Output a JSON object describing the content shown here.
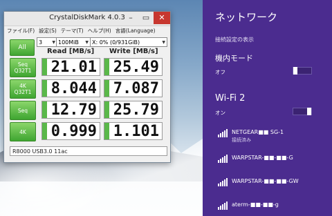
{
  "window": {
    "title": "CrystalDiskMark 4.0.3",
    "menu": [
      "ファイル(F)",
      "設定(S)",
      "テーマ(T)",
      "ヘルプ(H)",
      "言語(Language)"
    ],
    "all_label": "All",
    "runs": "3",
    "size": "100MiB",
    "drive": "X: 0% (0/931GiB)",
    "read_header": "Read [MB/s]",
    "write_header": "Write [MB/s]",
    "tests": [
      {
        "line1": "Seq",
        "line2": "Q32T1",
        "read": "21.01",
        "write": "25.49"
      },
      {
        "line1": "4K",
        "line2": "Q32T1",
        "read": "8.044",
        "write": "7.087"
      },
      {
        "line1": "Seq",
        "line2": "",
        "read": "12.79",
        "write": "25.79"
      },
      {
        "line1": "4K",
        "line2": "",
        "read": "0.999",
        "write": "1.101"
      }
    ],
    "comment": "R8000 USB3.0 11ac"
  },
  "network": {
    "title": "ネットワーク",
    "show_settings": "接続設定の表示",
    "airplane": {
      "label": "機内モード",
      "state": "オフ",
      "on": false
    },
    "wifi": {
      "label": "Wi-Fi 2",
      "state": "オン",
      "on": true
    },
    "networks": [
      {
        "name": "NETGEAR■■ SG-1",
        "status": "接続済み"
      },
      {
        "name": "WARPSTAR-■■-■■-G",
        "status": ""
      },
      {
        "name": "WARPSTAR-■■-■■-GW",
        "status": ""
      },
      {
        "name": "aterm-■■-■■-g",
        "status": ""
      }
    ]
  },
  "colors": {
    "flyout_bg": "#4b2c8f",
    "accent_green": "#3fa531",
    "close_red": "#c7372f"
  },
  "icons": {
    "wifi": "wifi-signal-icon",
    "close": "close-icon",
    "minimize": "minimize-icon",
    "maximize": "maximize-icon",
    "dropdown": "chevron-down-icon"
  }
}
